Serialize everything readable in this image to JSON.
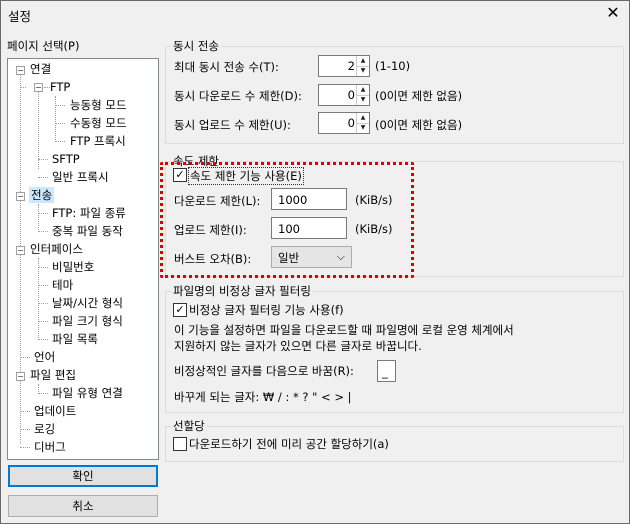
{
  "window": {
    "title": "설정",
    "close_glyph": "✕"
  },
  "sidebar": {
    "label": "페이지 선택(P)",
    "items": [
      {
        "label": "연결",
        "toggle": "−"
      },
      {
        "label": "FTP",
        "toggle": "−"
      },
      {
        "label": "능동형 모드"
      },
      {
        "label": "수동형 모드"
      },
      {
        "label": "FTP 프록시"
      },
      {
        "label": "SFTP"
      },
      {
        "label": "일반 프록시"
      },
      {
        "label": "전송",
        "toggle": "−"
      },
      {
        "label": "FTP: 파일 종류"
      },
      {
        "label": "중복 파일 동작"
      },
      {
        "label": "인터페이스",
        "toggle": "−"
      },
      {
        "label": "비밀번호"
      },
      {
        "label": "테마"
      },
      {
        "label": "날짜/시간 형식"
      },
      {
        "label": "파일 크기 형식"
      },
      {
        "label": "파일 목록"
      },
      {
        "label": "언어"
      },
      {
        "label": "파일 편집",
        "toggle": "−"
      },
      {
        "label": "파일 유형 연결"
      },
      {
        "label": "업데이트"
      },
      {
        "label": "로깅"
      },
      {
        "label": "디버그"
      }
    ]
  },
  "buttons": {
    "ok": "확인",
    "cancel": "취소"
  },
  "concurrent": {
    "title": "동시 전송",
    "max_label": "최대 동시 전송 수(T):",
    "max_value": "2",
    "max_hint": "(1-10)",
    "down_label": "동시 다운로드 수 제한(D):",
    "down_value": "0",
    "down_hint": "(0이면 제한 없음)",
    "up_label": "동시 업로드 수 제한(U):",
    "up_value": "0",
    "up_hint": "(0이면 제한 없음)"
  },
  "speed": {
    "title": "속도 제한",
    "enable_label": "속도 제한 기능 사용(E)",
    "enabled": true,
    "download_label": "다운로드 제한(L):",
    "download_value": "1000",
    "download_unit": "(KiB/s)",
    "upload_label": "업로드 제한(I):",
    "upload_value": "100",
    "upload_unit": "(KiB/s)",
    "burst_label": "버스트 오차(B):",
    "burst_value": "일반",
    "check_glyph": "✓",
    "dropdown_glyph": "⌵",
    "highlight_color": "#e00000"
  },
  "filter": {
    "title": "파일명의 비정상 글자 필터링",
    "enable_label": "비정상 글자 필터링 기능 사용(f)",
    "enabled": true,
    "desc_line1": "이 기능을 설정하면 파일을 다운로드할 때 파일명에 로컬 운영 체계에서",
    "desc_line2": "지원하지 않는 글자가 있으면 다른 글자로 바꿉니다.",
    "replace_label": "비정상적인 글자를 다음으로 바꿈(R):",
    "replace_value": "_",
    "changed_label": "바꾸게 되는 글자: ₩ / : * ? \" < > |"
  },
  "prealloc": {
    "title": "선할당",
    "enable_label": "다운로드하기 전에 미리 공간 할당하기(a)",
    "enabled": false
  },
  "colors": {
    "selection": "#cce8ff",
    "focus_border": "#0078d7"
  }
}
